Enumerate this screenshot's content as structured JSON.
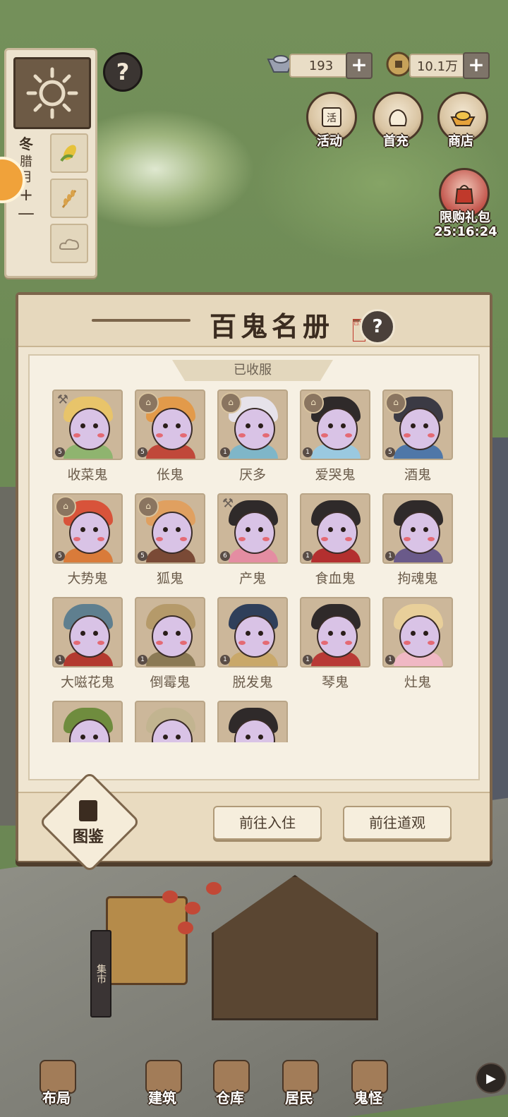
{
  "colors": {
    "panel_bg": "#efe5d1",
    "panel_border": "#7c654b",
    "label_text": "#6b5c4b",
    "grass": "#6f8a55"
  },
  "currency": {
    "silver": "193",
    "coins": "10.1万",
    "add": "+"
  },
  "season": {
    "season_name": "冬",
    "month_1": "腊",
    "month_2": "月",
    "plus": "+",
    "minus": "—",
    "icons": [
      "sun-icon",
      "corn-icon",
      "wheat-icon",
      "cloud-icon"
    ]
  },
  "top_buttons": {
    "activity": "活动",
    "first_charge": "首充",
    "shop": "商店",
    "limited_pack": "限购礼包",
    "limited_timer": "25:16:24"
  },
  "modal": {
    "title": "百鬼名册",
    "seal_text": "百鬼",
    "help": "?",
    "section_label": "已收服",
    "guide_label": "图鉴",
    "btn_checkin": "前往入住",
    "btn_temple": "前往道观"
  },
  "ghosts": [
    {
      "name": "收菜鬼",
      "level": "5",
      "badge": "hammer",
      "hat": "#e8c46a",
      "cloth": "#8fb46f"
    },
    {
      "name": "伥鬼",
      "level": "5",
      "badge": "crown",
      "hat": "#e29a4a",
      "cloth": "#c0483a"
    },
    {
      "name": "厌多",
      "level": "1",
      "badge": "crown",
      "hat": "#e6e2ea",
      "cloth": "#7fb6c8"
    },
    {
      "name": "爱哭鬼",
      "level": "1",
      "badge": "crown",
      "hat": "#2f2a2a",
      "cloth": "#9ac9e0"
    },
    {
      "name": "酒鬼",
      "level": "5",
      "badge": "crown",
      "hat": "#3b3a44",
      "cloth": "#4f77a8"
    },
    {
      "name": "大势鬼",
      "level": "5",
      "badge": "crown",
      "hat": "#d8533a",
      "cloth": "#d97b3a"
    },
    {
      "name": "狐鬼",
      "level": "5",
      "badge": "crown",
      "hat": "#e0a060",
      "cloth": "#7a4a36"
    },
    {
      "name": "产鬼",
      "level": "6",
      "badge": "hammer",
      "hat": "#2f2a2a",
      "cloth": "#e48da2"
    },
    {
      "name": "食血鬼",
      "level": "1",
      "badge": "none",
      "hat": "#2f2a2a",
      "cloth": "#b32f2f"
    },
    {
      "name": "拘魂鬼",
      "level": "1",
      "badge": "none",
      "hat": "#2f2a2a",
      "cloth": "#6a5a8a"
    },
    {
      "name": "大嗞花鬼",
      "level": "1",
      "badge": "none",
      "hat": "#5f7f8f",
      "cloth": "#b33a2f"
    },
    {
      "name": "倒霉鬼",
      "level": "1",
      "badge": "none",
      "hat": "#b59a6a",
      "cloth": "#8b7a55"
    },
    {
      "name": "脱发鬼",
      "level": "1",
      "badge": "none",
      "hat": "#2f3f5a",
      "cloth": "#c9a86a"
    },
    {
      "name": "琴鬼",
      "level": "1",
      "badge": "none",
      "hat": "#2f2a2a",
      "cloth": "#b83a36"
    },
    {
      "name": "灶鬼",
      "level": "1",
      "badge": "none",
      "hat": "#e8cf9a",
      "cloth": "#f0b8c4"
    },
    {
      "name": "",
      "level": "",
      "badge": "none",
      "hat": "#6f8c3e",
      "cloth": "#7a5a3a"
    },
    {
      "name": "",
      "level": "",
      "badge": "none",
      "hat": "#c2b490",
      "cloth": "#6a6a6a"
    },
    {
      "name": "",
      "level": "",
      "badge": "none",
      "hat": "#2f2a2a",
      "cloth": "#cfd8e8"
    }
  ],
  "market_sign": "集市",
  "bottom_nav": [
    {
      "label": "布局",
      "icon": "layout-icon"
    },
    {
      "label": "建筑",
      "icon": "building-icon"
    },
    {
      "label": "仓库",
      "icon": "warehouse-icon"
    },
    {
      "label": "居民",
      "icon": "resident-icon"
    },
    {
      "label": "鬼怪",
      "icon": "ghost-icon"
    }
  ]
}
